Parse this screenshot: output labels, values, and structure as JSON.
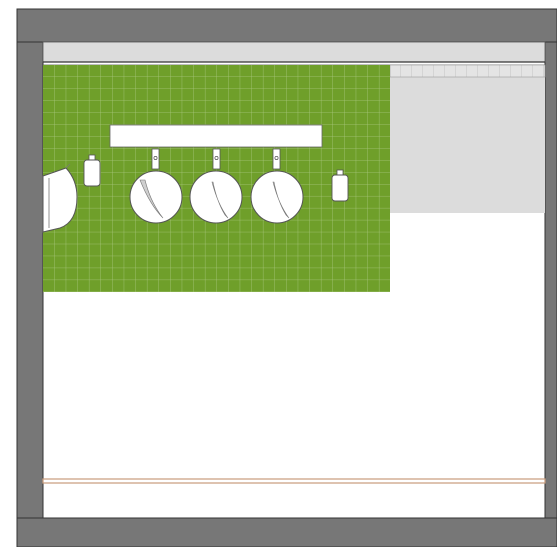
{
  "plan": {
    "kind": "bathroom-elevation",
    "colors": {
      "wall": "#777777",
      "wall_edge": "#333333",
      "tile": "#6f9f2a",
      "grout": "#a9c77e",
      "ceiling_strip": "#dcdcdc",
      "grey_panel": "#dcdcdc",
      "fixture_fill": "#ffffff",
      "fixture_stroke": "#555555",
      "baseboard": "#c79b7b"
    },
    "fixtures": {
      "sinks": 3,
      "soap_dispensers": 2,
      "mirrors": 1,
      "hand_dryers": 1
    },
    "tile_grid": {
      "columns": 30,
      "rows": 19
    }
  }
}
